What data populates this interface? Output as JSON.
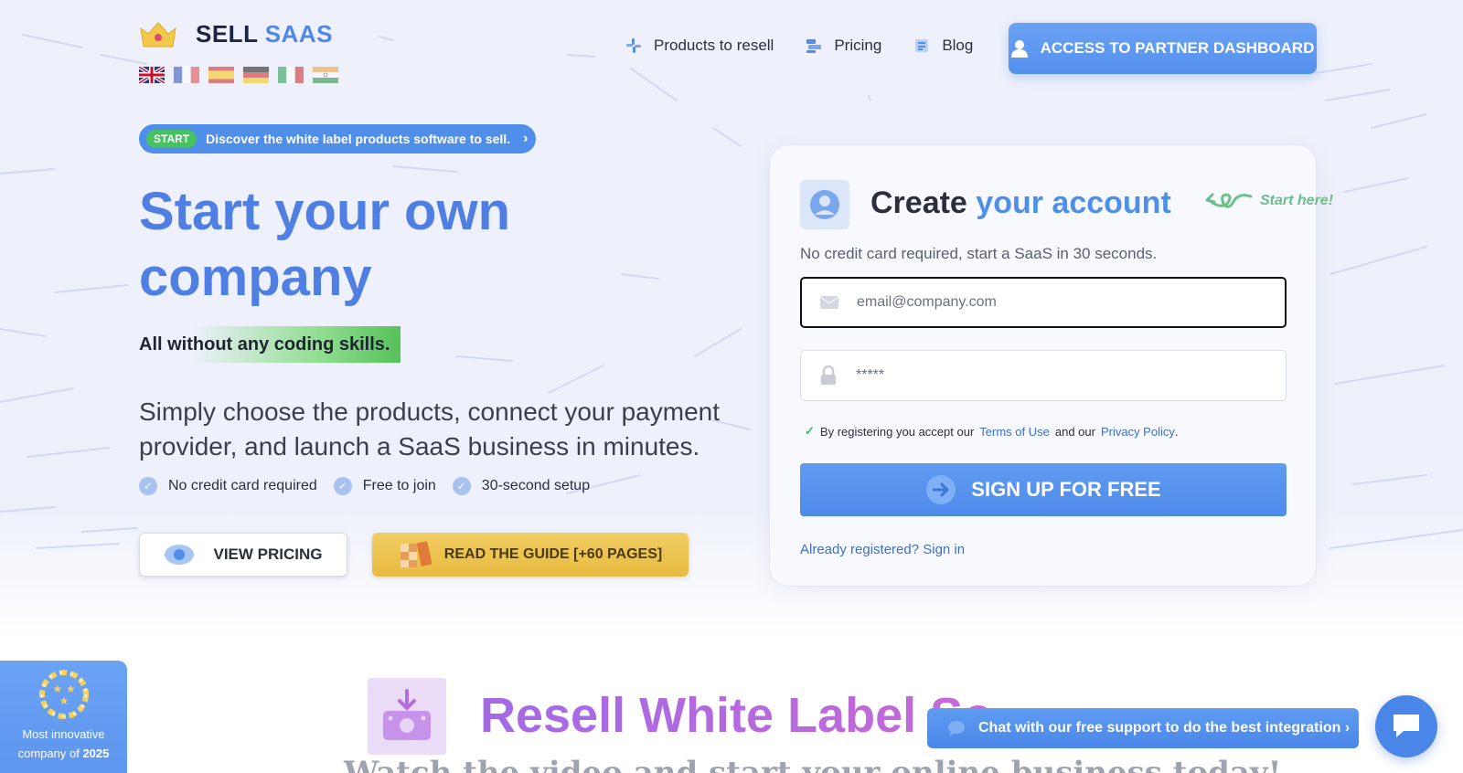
{
  "header": {
    "logo_main": "SELL",
    "logo_accent": "SAAS",
    "languages": [
      "English",
      "Français",
      "Español",
      "Deutsch",
      "Italiano",
      "Hindi"
    ],
    "nav": [
      {
        "label": "Products to resell",
        "icon": "grid-icon"
      },
      {
        "label": "Pricing",
        "icon": "pricing-icon"
      },
      {
        "label": "Blog",
        "icon": "blog-icon"
      }
    ],
    "partner_button": "ACCESS TO PARTNER DASHBOARD"
  },
  "hero": {
    "badge": "START",
    "pill_text": "Discover the white label products software to sell.",
    "headline": "Start your own company",
    "highlight": "All without any coding skills.",
    "description": "Simply choose the products, connect your payment provider, and launch a SaaS business in minutes.",
    "checks": [
      "No credit card required",
      "Free to join",
      "30-second setup"
    ],
    "pricing_button": "VIEW PRICING",
    "guide_button": "READ THE GUIDE [+60 PAGES]"
  },
  "signup_card": {
    "title_main": "Create",
    "title_accent": "your account",
    "start_here": "Start here!",
    "subtitle": "No credit card required, start a SaaS in 30 seconds.",
    "email_placeholder": "email@company.com",
    "password_placeholder": "*****",
    "terms_prefix": "By registering you accept our",
    "terms_link": "Terms of Use",
    "terms_mid": "and our",
    "privacy_link": "Privacy Policy",
    "terms_suffix": ".",
    "submit": "SIGN UP FOR FREE",
    "signin": "Already registered? Sign in"
  },
  "award": {
    "line1": "Most innovative",
    "line2_prefix": "company of",
    "year": "2025"
  },
  "section": {
    "title": "Resell White Label Software",
    "subtitle": "Watch the video and start your online business today!"
  },
  "chat": {
    "label": "Chat with our free support to do the best integration ›"
  },
  "colors": {
    "brand_blue": "#4f8fe9",
    "headline_blue": "#4f7fe3",
    "green": "#47c263",
    "gold": "#e8bb40",
    "purple": "#a36ae6"
  }
}
